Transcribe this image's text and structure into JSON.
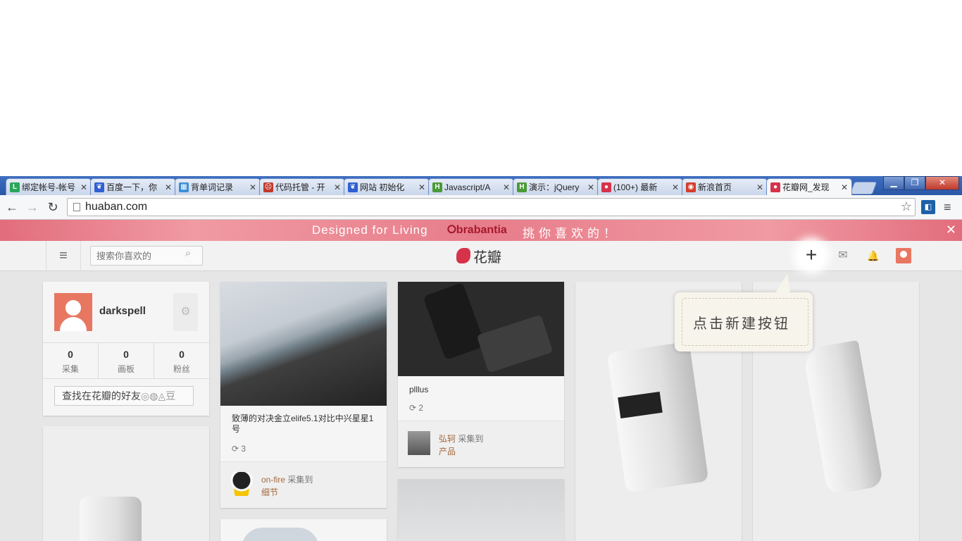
{
  "tabs": [
    {
      "label": "绑定帐号-帐号",
      "favicon": "L",
      "color": "#2aa55a"
    },
    {
      "label": "百度一下，你",
      "favicon": "❦",
      "color": "#2f5fd0"
    },
    {
      "label": "背单词记录",
      "favicon": "▦",
      "color": "#3b8ed6"
    },
    {
      "label": "代码托管 - 开",
      "favicon": "☹",
      "color": "#c0392b"
    },
    {
      "label": "网站 初始化",
      "favicon": "❦",
      "color": "#2f5fd0"
    },
    {
      "label": "Javascript/A",
      "favicon": "H",
      "color": "#4a9a37"
    },
    {
      "label": "演示：jQuery",
      "favicon": "H",
      "color": "#4a9a37"
    },
    {
      "label": "(100+) 最新",
      "favicon": "●",
      "color": "#d6334a"
    },
    {
      "label": "新浪首页",
      "favicon": "◉",
      "color": "#d53b2b"
    },
    {
      "label": "花瓣网_发现",
      "favicon": "●",
      "color": "#d6334a",
      "active": true
    }
  ],
  "tab_close_glyph": "✕",
  "window_controls": {
    "minimize": "▁",
    "maximize": "❐",
    "close": "✕"
  },
  "toolbar": {
    "back": "←",
    "forward": "→",
    "reload": "↻",
    "url": "huaban.com",
    "star": "☆",
    "menu": "≡",
    "extension": "◧"
  },
  "banner": {
    "text": "Designed for Living",
    "brand": "⭘brabantia",
    "slogan": "挑你喜欢的！",
    "close": "✕"
  },
  "header": {
    "menu": "≡",
    "search_placeholder": "搜索你喜欢的",
    "search_icon": "⌕",
    "logo": "花瓣",
    "add": "+",
    "mail": "✉",
    "bell": "🔔"
  },
  "tooltip": {
    "text": "点击新建按钮"
  },
  "profile": {
    "name": "darkspell",
    "gear": "⚙",
    "stats": [
      {
        "num": "0",
        "label": "采集"
      },
      {
        "num": "0",
        "label": "画板"
      },
      {
        "num": "0",
        "label": "粉丝"
      }
    ],
    "find_friends": "查找在花瓣的好友",
    "find_friends_icons": "◎◍◬豆"
  },
  "pins": {
    "p1": {
      "title": "致薄的对决金立elife5.1对比中兴星星1号",
      "repin_icon": "⟳",
      "repins": "3",
      "user": "on-fire",
      "action": "采集到",
      "board": "细节"
    },
    "p2": {
      "title": "plllus",
      "repin_icon": "⟳",
      "repins": "2",
      "user": "弘轲",
      "action": "采集到",
      "board": "产品"
    }
  }
}
